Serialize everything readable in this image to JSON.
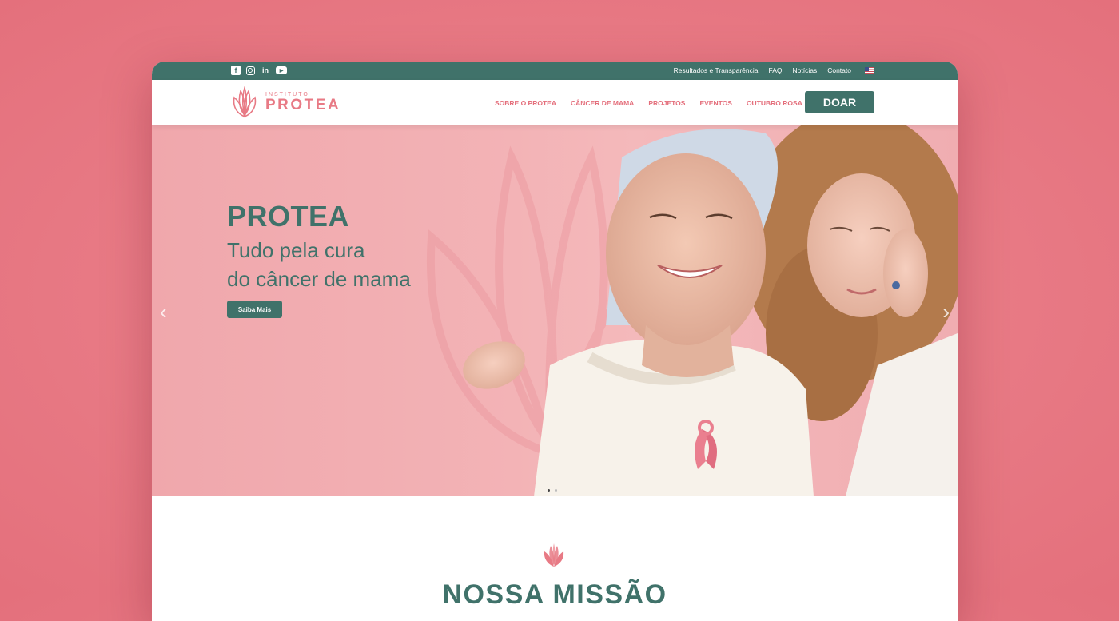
{
  "topbar": {
    "social": [
      "facebook-icon",
      "instagram-icon",
      "linkedin-icon",
      "youtube-icon"
    ],
    "links": [
      "Resultados e Transparência",
      "FAQ",
      "Notícias",
      "Contato"
    ],
    "language": "us-flag-icon"
  },
  "header": {
    "logo_small": "INSTITUTO",
    "logo_big": "PROTEA",
    "nav": [
      "SOBRE O PROTEA",
      "CÂNCER DE MAMA",
      "PROJETOS",
      "EVENTOS",
      "OUTUBRO ROSA"
    ],
    "donate_label": "DOAR"
  },
  "hero": {
    "title": "PROTEA",
    "subtitle_line1": "Tudo pela cura",
    "subtitle_line2": "do câncer de mama",
    "button_label": "Saiba Mais",
    "slides_total": 2,
    "slide_active": 1
  },
  "mission": {
    "title": "NOSSA MISSÃO"
  },
  "colors": {
    "page_background": "#e87a85",
    "brand_green": "#40726a",
    "brand_pink": "#e87a85",
    "hero_pink": "#f3b3b6"
  }
}
